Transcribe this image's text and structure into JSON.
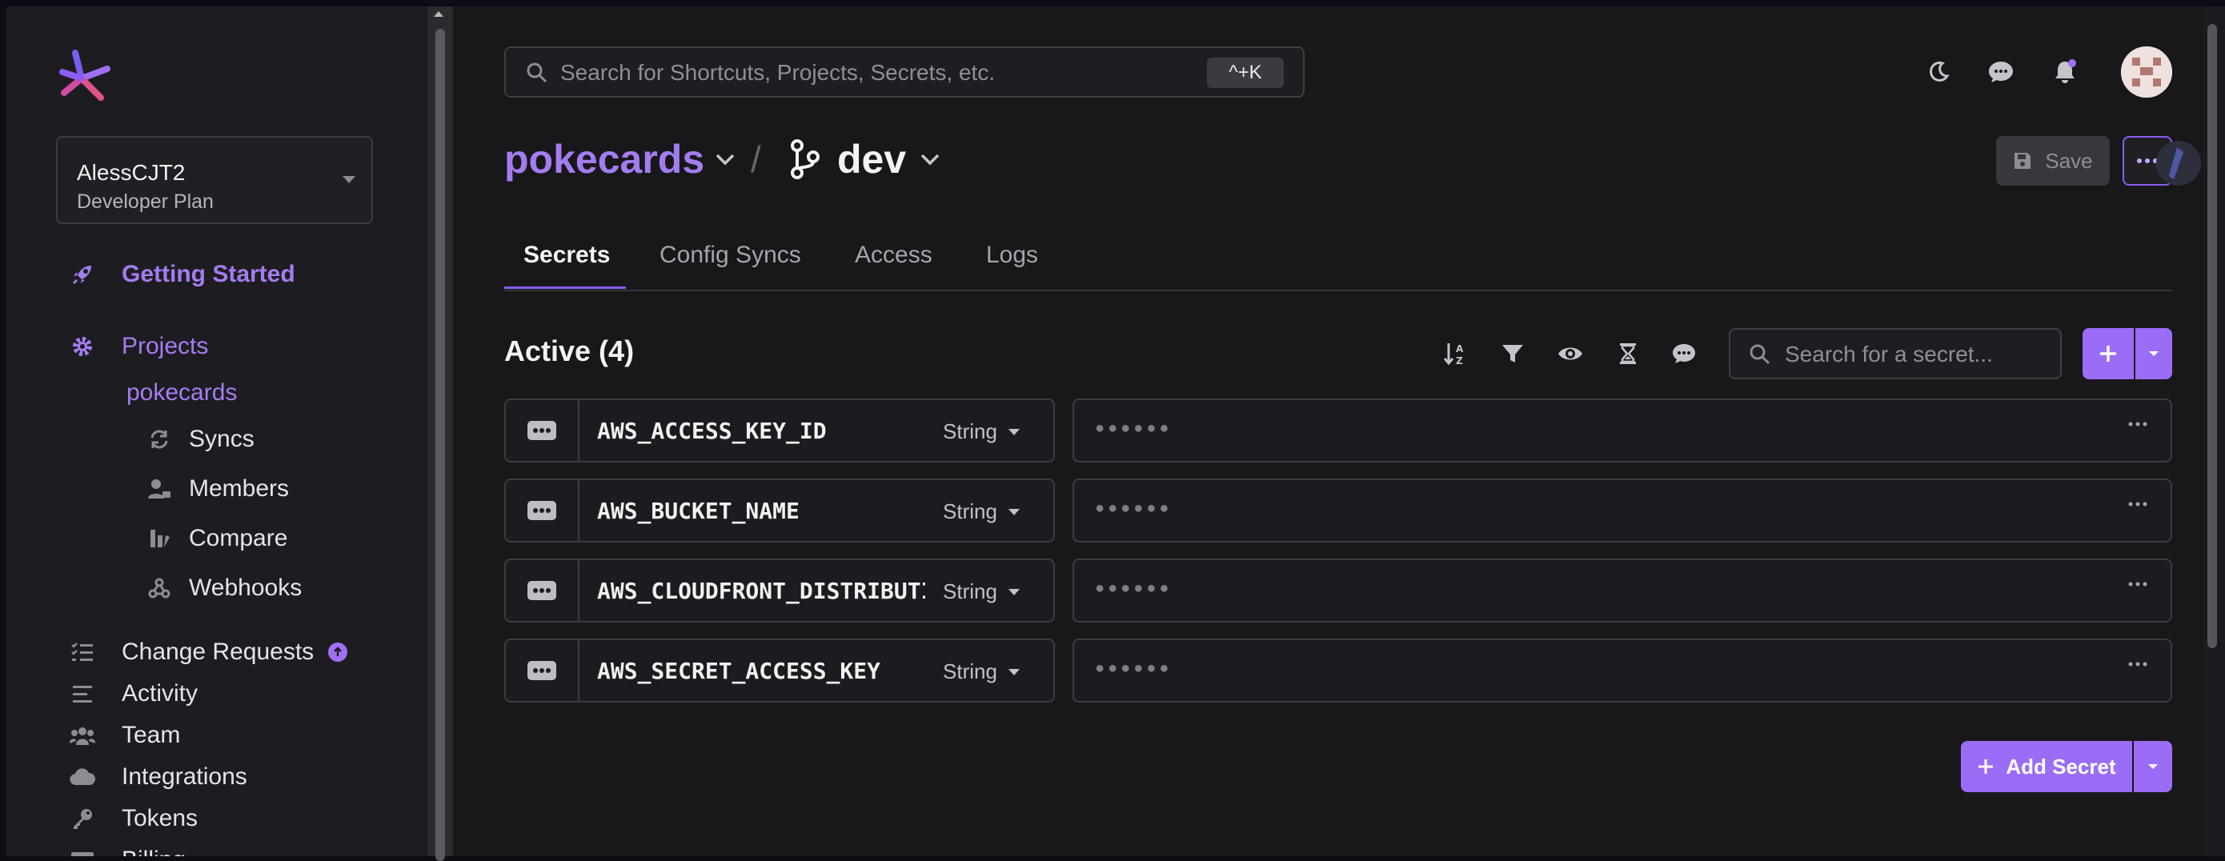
{
  "sidebar": {
    "org": {
      "name": "AlessCJT2",
      "plan": "Developer Plan"
    },
    "getting_started": "Getting Started",
    "projects": "Projects",
    "project": "pokecards",
    "project_items": [
      "Syncs",
      "Members",
      "Compare",
      "Webhooks"
    ],
    "items": [
      "Change Requests",
      "Activity",
      "Team",
      "Integrations",
      "Tokens",
      "Billing"
    ]
  },
  "search": {
    "placeholder": "Search for Shortcuts, Projects, Secrets, etc.",
    "shortcut": "^+K"
  },
  "breadcrumb": {
    "project": "pokecards",
    "separator": "/",
    "config": "dev"
  },
  "actions": {
    "save": "Save"
  },
  "tabs": [
    "Secrets",
    "Config Syncs",
    "Access",
    "Logs"
  ],
  "secrets": {
    "title": "Active (4)",
    "search_placeholder": "Search for a secret...",
    "rows": [
      {
        "name": "AWS_ACCESS_KEY_ID",
        "type": "String",
        "value": "●●●●●●"
      },
      {
        "name": "AWS_BUCKET_NAME",
        "type": "String",
        "value": "●●●●●●"
      },
      {
        "name": "AWS_CLOUDFRONT_DISTRIBUTI",
        "type": "String",
        "value": "●●●●●●"
      },
      {
        "name": "AWS_SECRET_ACCESS_KEY",
        "type": "String",
        "value": "●●●●●●"
      }
    ],
    "add_label": "Add Secret"
  },
  "colors": {
    "accent": "#9b6cf5",
    "accent_text": "#a57cf0",
    "background": "#18181b",
    "sidebar": "#1d1d21"
  },
  "icons": {
    "top_bar": [
      "moon-icon",
      "chat-icon",
      "bell-icon"
    ],
    "toolbar": [
      "sort-icon",
      "filter-icon",
      "eye-icon",
      "hourglass-icon",
      "comment-icon"
    ]
  }
}
